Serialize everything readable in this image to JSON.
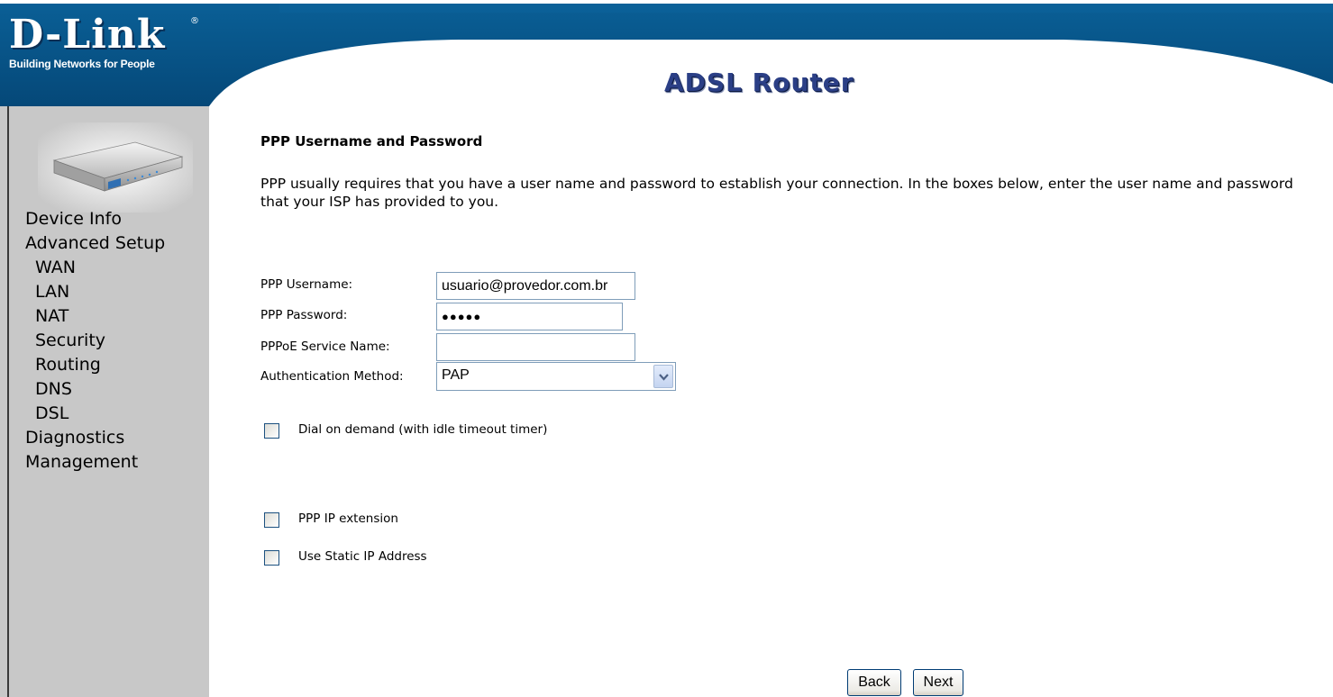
{
  "brand": {
    "logo_text": "D-Link",
    "registered_mark": "®",
    "tagline": "Building Networks for People",
    "product_title": "ADSL Router",
    "header_color": "#05568b"
  },
  "sidebar": {
    "items": [
      {
        "label": "Device Info",
        "level": 0
      },
      {
        "label": "Advanced Setup",
        "level": 0
      },
      {
        "label": "WAN",
        "level": 1
      },
      {
        "label": "LAN",
        "level": 1
      },
      {
        "label": "NAT",
        "level": 1
      },
      {
        "label": "Security",
        "level": 1
      },
      {
        "label": "Routing",
        "level": 1
      },
      {
        "label": "DNS",
        "level": 1
      },
      {
        "label": "DSL",
        "level": 1
      },
      {
        "label": "Diagnostics",
        "level": 0
      },
      {
        "label": "Management",
        "level": 0
      }
    ]
  },
  "main": {
    "title": "PPP Username and Password",
    "description_line1": "PPP usually requires that you have a user name and password to establish your connection. In the boxes below, enter the user name and password",
    "description_line2": "that your ISP has provided to you.",
    "form": {
      "username_label": "PPP Username:",
      "username_value": "usuario@provedor.com.br",
      "password_label": "PPP Password:",
      "password_value": "●●●●●",
      "service_label": "PPPoE Service Name:",
      "service_value": "",
      "auth_label": "Authentication Method:",
      "auth_value": "PAP"
    },
    "options": {
      "dial_on_demand": "Dial on demand (with idle timeout timer)",
      "ip_extension": "PPP IP extension",
      "static_ip": "Use Static IP Address"
    },
    "buttons": {
      "back": "Back",
      "next": "Next"
    }
  }
}
